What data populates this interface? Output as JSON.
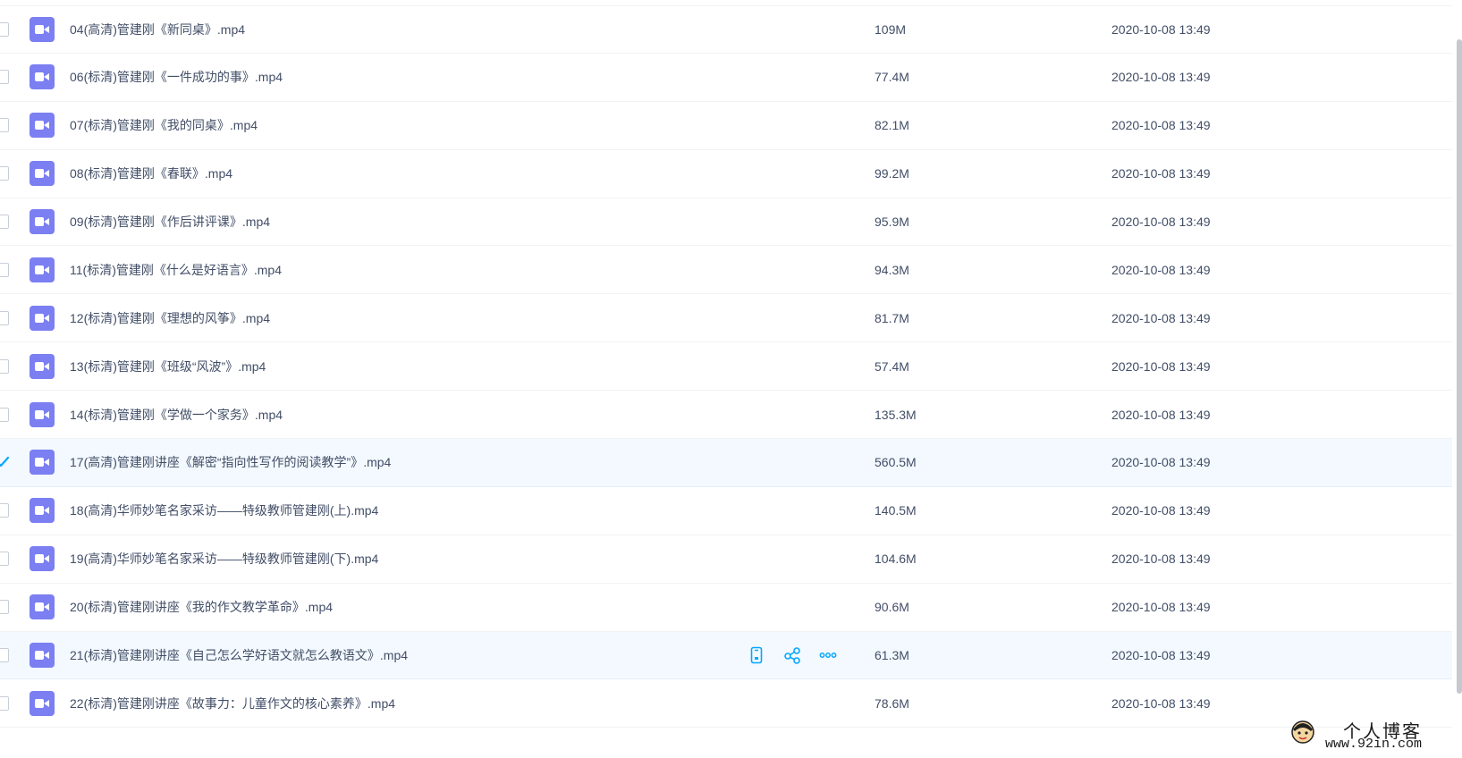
{
  "files": [
    {
      "name": "04(高清)管建刚《新同桌》.mp4",
      "size": "109M",
      "date": "2020-10-08 13:49",
      "checked": false,
      "hovered": false
    },
    {
      "name": "06(标清)管建刚《一件成功的事》.mp4",
      "size": "77.4M",
      "date": "2020-10-08 13:49",
      "checked": false,
      "hovered": false
    },
    {
      "name": "07(标清)管建刚《我的同桌》.mp4",
      "size": "82.1M",
      "date": "2020-10-08 13:49",
      "checked": false,
      "hovered": false
    },
    {
      "name": "08(标清)管建刚《春联》.mp4",
      "size": "99.2M",
      "date": "2020-10-08 13:49",
      "checked": false,
      "hovered": false
    },
    {
      "name": "09(标清)管建刚《作后讲评课》.mp4",
      "size": "95.9M",
      "date": "2020-10-08 13:49",
      "checked": false,
      "hovered": false
    },
    {
      "name": "11(标清)管建刚《什么是好语言》.mp4",
      "size": "94.3M",
      "date": "2020-10-08 13:49",
      "checked": false,
      "hovered": false
    },
    {
      "name": "12(标清)管建刚《理想的风筝》.mp4",
      "size": "81.7M",
      "date": "2020-10-08 13:49",
      "checked": false,
      "hovered": false
    },
    {
      "name": "13(标清)管建刚《班级“风波”》.mp4",
      "size": "57.4M",
      "date": "2020-10-08 13:49",
      "checked": false,
      "hovered": false
    },
    {
      "name": "14(标清)管建刚《学做一个家务》.mp4",
      "size": "135.3M",
      "date": "2020-10-08 13:49",
      "checked": false,
      "hovered": false
    },
    {
      "name": "17(高清)管建刚讲座《解密“指向性写作的阅读教学”》.mp4",
      "size": "560.5M",
      "date": "2020-10-08 13:49",
      "checked": true,
      "hovered": false
    },
    {
      "name": "18(高清)华师妙笔名家采访——特级教师管建刚(上).mp4",
      "size": "140.5M",
      "date": "2020-10-08 13:49",
      "checked": false,
      "hovered": false
    },
    {
      "name": "19(高清)华师妙笔名家采访——特级教师管建刚(下).mp4",
      "size": "104.6M",
      "date": "2020-10-08 13:49",
      "checked": false,
      "hovered": false
    },
    {
      "name": "20(标清)管建刚讲座《我的作文教学革命》.mp4",
      "size": "90.6M",
      "date": "2020-10-08 13:49",
      "checked": false,
      "hovered": false
    },
    {
      "name": "21(标清)管建刚讲座《自己怎么学好语文就怎么教语文》.mp4",
      "size": "61.3M",
      "date": "2020-10-08 13:49",
      "checked": false,
      "hovered": true
    },
    {
      "name": "22(标清)管建刚讲座《故事力：儿童作文的核心素养》.mp4",
      "size": "78.6M",
      "date": "2020-10-08 13:49",
      "checked": false,
      "hovered": false
    }
  ],
  "row_actions": [
    "phone-icon",
    "share-icon",
    "more-icon"
  ],
  "watermark": {
    "title": "个人博客",
    "url": "www.92in.com"
  },
  "colors": {
    "accent": "#06a7ff",
    "file_icon": "#7b7ff2",
    "selected_bg": "#f3f9fe"
  }
}
